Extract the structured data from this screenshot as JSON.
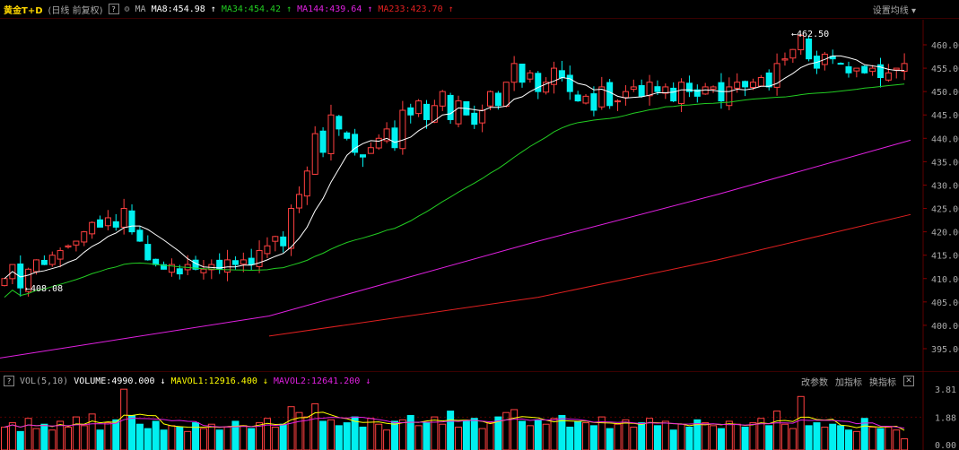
{
  "header": {
    "symbol": "黄金T+D",
    "mode": "(日线 前复权)",
    "help": "?",
    "ma_label": "MA",
    "ma8": "MA8:454.98",
    "ma34": "MA34:454.42",
    "ma144": "MA144:439.64",
    "ma233": "MA233:423.70",
    "settings": "设置均线 ▾"
  },
  "vol_header": {
    "help": "?",
    "label": "VOL(5,10)",
    "volume": "VOLUME:4990.000",
    "mavol1": "MAVOL1:12916.400",
    "mavol2": "MAVOL2:12641.200",
    "btn1": "改参数",
    "btn2": "加指标",
    "btn3": "换指标",
    "close": "✕"
  },
  "colors": {
    "up": "#ff4040",
    "down": "#00f0f0",
    "ma8": "#ffffff",
    "ma34": "#22cc22",
    "ma144": "#e020e0",
    "ma233": "#e02020"
  },
  "price_axis": [
    "460.00",
    "455.00",
    "450.00",
    "445.00",
    "440.00",
    "435.00",
    "430.00",
    "425.00",
    "420.00",
    "415.00",
    "410.00",
    "405.00",
    "400.00",
    "395.00"
  ],
  "vol_axis": [
    "3.81",
    "1.88",
    "0.00"
  ],
  "annotations": {
    "low": "408.08",
    "high": "462.50"
  },
  "chart_data": {
    "type": "candlestick",
    "closes": [
      410,
      413,
      408,
      412,
      414,
      413,
      415,
      416,
      417,
      418,
      420,
      422,
      421,
      423,
      421,
      425,
      420,
      418,
      414,
      413,
      412,
      413,
      411,
      413,
      412,
      412,
      413,
      412,
      414,
      413,
      414,
      413,
      416,
      417,
      419,
      417,
      425,
      428,
      433,
      441,
      437,
      445,
      442,
      440,
      437,
      436,
      438,
      440,
      442,
      438,
      446,
      445,
      448,
      444,
      447,
      450,
      444,
      448,
      445,
      443,
      446,
      450,
      447,
      452,
      456,
      452,
      454,
      450,
      452,
      455,
      453,
      450,
      448,
      449,
      446,
      451,
      447,
      448,
      450,
      451,
      449,
      452,
      450,
      451,
      448,
      452,
      450,
      449,
      451,
      451,
      448,
      451,
      452,
      451,
      452,
      453,
      451,
      456,
      457,
      459,
      462,
      457,
      455,
      458,
      457,
      456,
      454,
      455,
      454,
      455,
      453,
      454,
      455,
      456
    ],
    "volumes": [
      1.2,
      1.5,
      0.9,
      1.8,
      1.1,
      1.4,
      1.0,
      1.6,
      1.2,
      1.9,
      1.3,
      2.1,
      1.0,
      1.5,
      1.7,
      3.8,
      2.0,
      1.4,
      1.1,
      1.6,
      1.0,
      1.3,
      1.2,
      0.9,
      1.5,
      1.1,
      1.4,
      1.0,
      1.2,
      1.6,
      1.3,
      1.1,
      1.5,
      1.8,
      1.2,
      1.4,
      2.6,
      2.2,
      1.9,
      2.8,
      1.6,
      1.7,
      1.3,
      1.5,
      1.9,
      1.2,
      1.8,
      1.4,
      1.0,
      1.6,
      1.7,
      2.0,
      1.3,
      1.5,
      1.9,
      1.4,
      2.3,
      1.2,
      1.6,
      1.8,
      1.1,
      1.5,
      1.9,
      2.2,
      2.4,
      1.6,
      1.3,
      1.7,
      1.4,
      1.8,
      2.0,
      1.2,
      1.6,
      1.5,
      1.3,
      1.9,
      1.1,
      1.4,
      1.7,
      1.2,
      1.5,
      1.8,
      1.3,
      1.6,
      1.0,
      1.4,
      1.2,
      1.7,
      1.5,
      1.3,
      1.1,
      1.6,
      1.4,
      1.2,
      1.5,
      1.8,
      1.3,
      2.3,
      1.4,
      1.1,
      3.3,
      1.3,
      1.5,
      1.2,
      1.4,
      1.3,
      1.0,
      0.9,
      1.8,
      1.2,
      1.1,
      1.2,
      1.0,
      0.4
    ],
    "ma144": [
      [
        0,
        393
      ],
      [
        300,
        402
      ],
      [
        600,
        418
      ],
      [
        800,
        428
      ],
      [
        1015,
        439.6
      ]
    ],
    "ma233": [
      [
        300,
        397.7
      ],
      [
        600,
        406
      ],
      [
        800,
        414
      ],
      [
        1015,
        423.7
      ]
    ],
    "ylim": [
      390,
      465
    ],
    "vol_ylim": [
      0,
      3.81
    ]
  }
}
